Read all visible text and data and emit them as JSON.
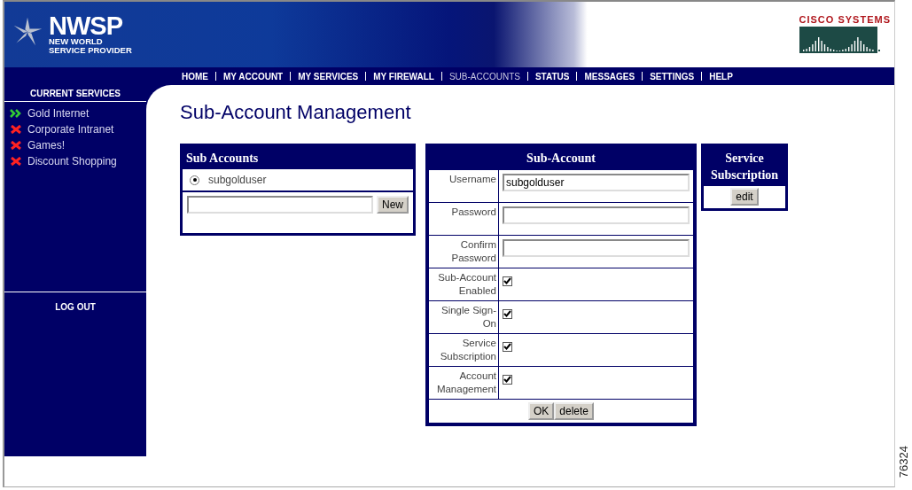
{
  "header": {
    "logo": "NWSP",
    "tagline_1": "NEW WORLD",
    "tagline_2": "SERVICE PROVIDER",
    "partner": "CISCO SYSTEMS"
  },
  "nav": [
    {
      "label": "HOME",
      "selected": false
    },
    {
      "label": "MY ACCOUNT",
      "selected": false
    },
    {
      "label": "MY SERVICES",
      "selected": false
    },
    {
      "label": "MY FIREWALL",
      "selected": false
    },
    {
      "label": "SUB-ACCOUNTS",
      "selected": true
    },
    {
      "label": "STATUS",
      "selected": false
    },
    {
      "label": "MESSAGES",
      "selected": false
    },
    {
      "label": "SETTINGS",
      "selected": false
    },
    {
      "label": "HELP",
      "selected": false
    }
  ],
  "sidebar": {
    "title": "CURRENT SERVICES",
    "items": [
      {
        "label": "Gold Internet",
        "active": true
      },
      {
        "label": "Corporate Intranet",
        "active": false
      },
      {
        "label": "Games!",
        "active": false
      },
      {
        "label": "Discount Shopping",
        "active": false
      }
    ],
    "logout": "LOG OUT"
  },
  "page_title": "Sub-Account Management",
  "sub_accounts": {
    "title": "Sub Accounts",
    "items": [
      {
        "label": "subgolduser",
        "selected": true
      }
    ],
    "new_button": "New"
  },
  "sub_account": {
    "title": "Sub-Account",
    "fields": [
      {
        "kind": "text",
        "label": "Username",
        "value": "subgolduser"
      },
      {
        "kind": "text",
        "label": "Password"
      },
      {
        "kind": "text",
        "label": "Confirm Password"
      },
      {
        "kind": "check",
        "label": "Sub-Account Enabled",
        "checked": true
      },
      {
        "kind": "check",
        "label": "Single Sign-On",
        "checked": true
      },
      {
        "kind": "check",
        "label": "Service Subscription",
        "checked": true
      },
      {
        "kind": "check",
        "label": "Account Management",
        "checked": true
      }
    ],
    "buttons": [
      "OK",
      "delete"
    ]
  },
  "service_subscription": {
    "title": "Service Subscription",
    "button": "edit"
  },
  "figure_number": "76324"
}
